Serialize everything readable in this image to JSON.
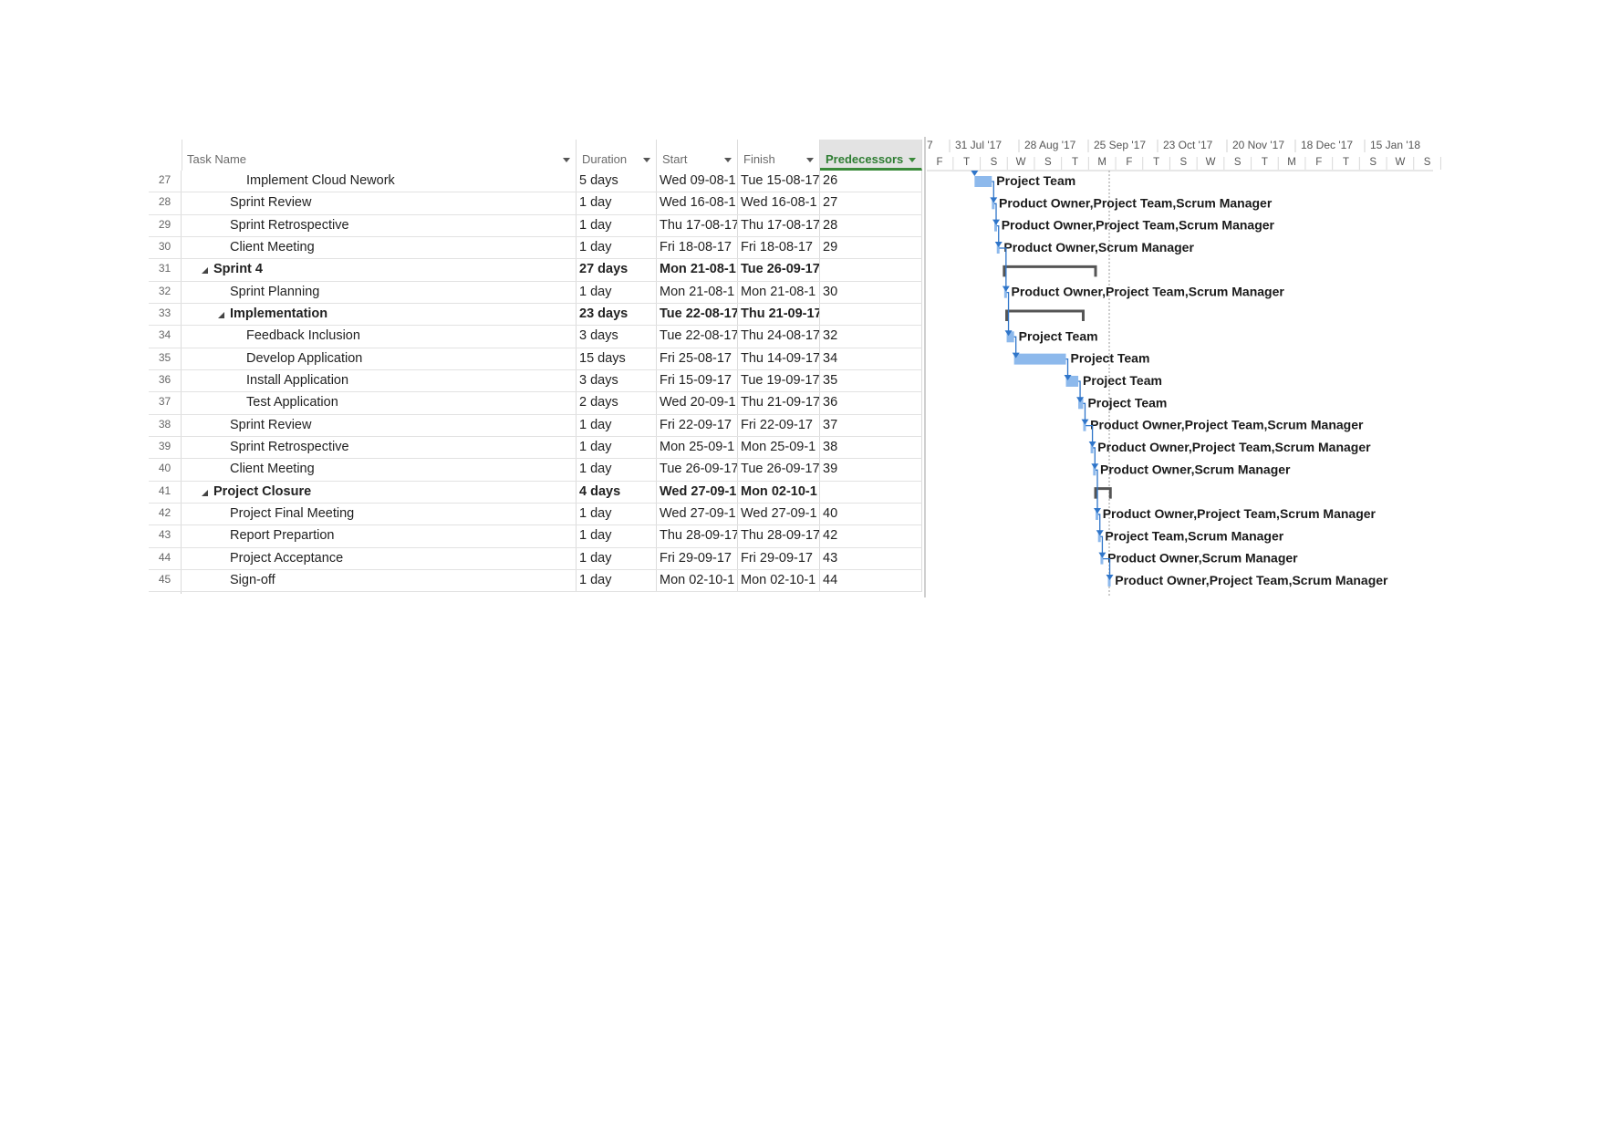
{
  "columns": {
    "task_name": "Task Name",
    "duration": "Duration",
    "start": "Start",
    "finish": "Finish",
    "predecessors": "Predecessors"
  },
  "timescale": {
    "major": [
      "7",
      "31 Jul '17",
      "28 Aug '17",
      "25 Sep '17",
      "23 Oct '17",
      "20 Nov '17",
      "18 Dec '17",
      "15 Jan '18"
    ],
    "minor": [
      "F",
      "T",
      "S",
      "W",
      "S",
      "T",
      "M",
      "F",
      "T",
      "S",
      "W",
      "S",
      "T",
      "M",
      "F",
      "T",
      "S",
      "W",
      "S"
    ]
  },
  "colors": {
    "bar": "#8db9ec",
    "link": "#2f75c9",
    "summary": "#555555",
    "accent": "#2e7d32"
  },
  "tasks": [
    {
      "id": "27",
      "name": "Implement Cloud Nework",
      "level": 3,
      "summary": false,
      "duration": "5 days",
      "start": "Wed 09-08-1",
      "finish": "Tue 15-08-17",
      "pred": "26",
      "resources": "Project Team"
    },
    {
      "id": "28",
      "name": "Sprint Review",
      "level": 2,
      "summary": false,
      "duration": "1 day",
      "start": "Wed 16-08-1",
      "finish": "Wed 16-08-1",
      "pred": "27",
      "resources": "Product Owner,Project Team,Scrum Manager"
    },
    {
      "id": "29",
      "name": "Sprint Retrospective",
      "level": 2,
      "summary": false,
      "duration": "1 day",
      "start": "Thu 17-08-17",
      "finish": "Thu 17-08-17",
      "pred": "28",
      "resources": "Product Owner,Project Team,Scrum Manager"
    },
    {
      "id": "30",
      "name": "Client Meeting",
      "level": 2,
      "summary": false,
      "duration": "1 day",
      "start": "Fri 18-08-17",
      "finish": "Fri 18-08-17",
      "pred": "29",
      "resources": "Product Owner,Scrum Manager"
    },
    {
      "id": "31",
      "name": "Sprint 4",
      "level": 1,
      "summary": true,
      "duration": "27 days",
      "start": "Mon 21-08-1",
      "finish": "Tue 26-09-17",
      "pred": "",
      "resources": ""
    },
    {
      "id": "32",
      "name": "Sprint Planning",
      "level": 2,
      "summary": false,
      "duration": "1 day",
      "start": "Mon 21-08-1",
      "finish": "Mon 21-08-1",
      "pred": "30",
      "resources": "Product Owner,Project Team,Scrum Manager"
    },
    {
      "id": "33",
      "name": "Implementation",
      "level": 2,
      "summary": true,
      "duration": "23 days",
      "start": "Tue 22-08-17",
      "finish": "Thu 21-09-17",
      "pred": "",
      "resources": ""
    },
    {
      "id": "34",
      "name": "Feedback Inclusion",
      "level": 3,
      "summary": false,
      "duration": "3 days",
      "start": "Tue 22-08-17",
      "finish": "Thu 24-08-17",
      "pred": "32",
      "resources": "Project Team"
    },
    {
      "id": "35",
      "name": "Develop Application",
      "level": 3,
      "summary": false,
      "duration": "15 days",
      "start": "Fri 25-08-17",
      "finish": "Thu 14-09-17",
      "pred": "34",
      "resources": "Project Team"
    },
    {
      "id": "36",
      "name": "Install Application",
      "level": 3,
      "summary": false,
      "duration": "3 days",
      "start": "Fri 15-09-17",
      "finish": "Tue 19-09-17",
      "pred": "35",
      "resources": "Project Team"
    },
    {
      "id": "37",
      "name": "Test Application",
      "level": 3,
      "summary": false,
      "duration": "2 days",
      "start": "Wed 20-09-1",
      "finish": "Thu 21-09-17",
      "pred": "36",
      "resources": "Project Team"
    },
    {
      "id": "38",
      "name": "Sprint Review",
      "level": 2,
      "summary": false,
      "duration": "1 day",
      "start": "Fri 22-09-17",
      "finish": "Fri 22-09-17",
      "pred": "37",
      "resources": "Product Owner,Project Team,Scrum Manager"
    },
    {
      "id": "39",
      "name": "Sprint Retrospective",
      "level": 2,
      "summary": false,
      "duration": "1 day",
      "start": "Mon 25-09-1",
      "finish": "Mon 25-09-1",
      "pred": "38",
      "resources": "Product Owner,Project Team,Scrum Manager"
    },
    {
      "id": "40",
      "name": "Client Meeting",
      "level": 2,
      "summary": false,
      "duration": "1 day",
      "start": "Tue 26-09-17",
      "finish": "Tue 26-09-17",
      "pred": "39",
      "resources": "Product Owner,Scrum Manager"
    },
    {
      "id": "41",
      "name": "Project Closure",
      "level": 1,
      "summary": true,
      "duration": "4 days",
      "start": "Wed 27-09-1",
      "finish": "Mon 02-10-1",
      "pred": "",
      "resources": ""
    },
    {
      "id": "42",
      "name": "Project Final Meeting",
      "level": 2,
      "summary": false,
      "duration": "1 day",
      "start": "Wed 27-09-1",
      "finish": "Wed 27-09-1",
      "pred": "40",
      "resources": "Product Owner,Project Team,Scrum Manager"
    },
    {
      "id": "43",
      "name": "Report Prepartion",
      "level": 2,
      "summary": false,
      "duration": "1 day",
      "start": "Thu 28-09-17",
      "finish": "Thu 28-09-17",
      "pred": "42",
      "resources": "Project Team,Scrum Manager"
    },
    {
      "id": "44",
      "name": "Project Acceptance",
      "level": 2,
      "summary": false,
      "duration": "1 day",
      "start": "Fri 29-09-17",
      "finish": "Fri 29-09-17",
      "pred": "43",
      "resources": "Product Owner,Scrum Manager"
    },
    {
      "id": "45",
      "name": "Sign-off",
      "level": 2,
      "summary": false,
      "duration": "1 day",
      "start": "Mon 02-10-1",
      "finish": "Mon 02-10-1",
      "pred": "44",
      "resources": "Product Owner,Project Team,Scrum Manager"
    }
  ]
}
